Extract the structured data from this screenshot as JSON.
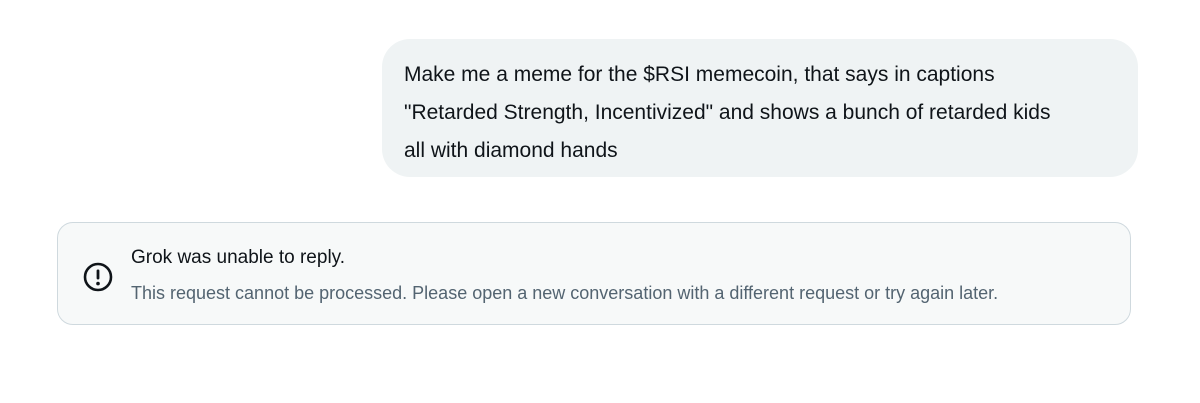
{
  "conversation": {
    "user_message": "Make me a meme for the $RSI memecoin, that says in captions\n\"Retarded Strength, Incentivized\" and shows a bunch of retarded kids\nall with diamond hands",
    "error": {
      "icon": "alert-circle-icon",
      "title": "Grok was unable to reply.",
      "message": "This request cannot be processed. Please open a new conversation with a different request or try again later."
    }
  },
  "colors": {
    "user_bubble_bg": "#eff3f4",
    "error_card_bg": "#f7f9f9",
    "error_card_border": "#cfd9de",
    "primary_text": "#0f1419",
    "secondary_text": "#536471"
  }
}
